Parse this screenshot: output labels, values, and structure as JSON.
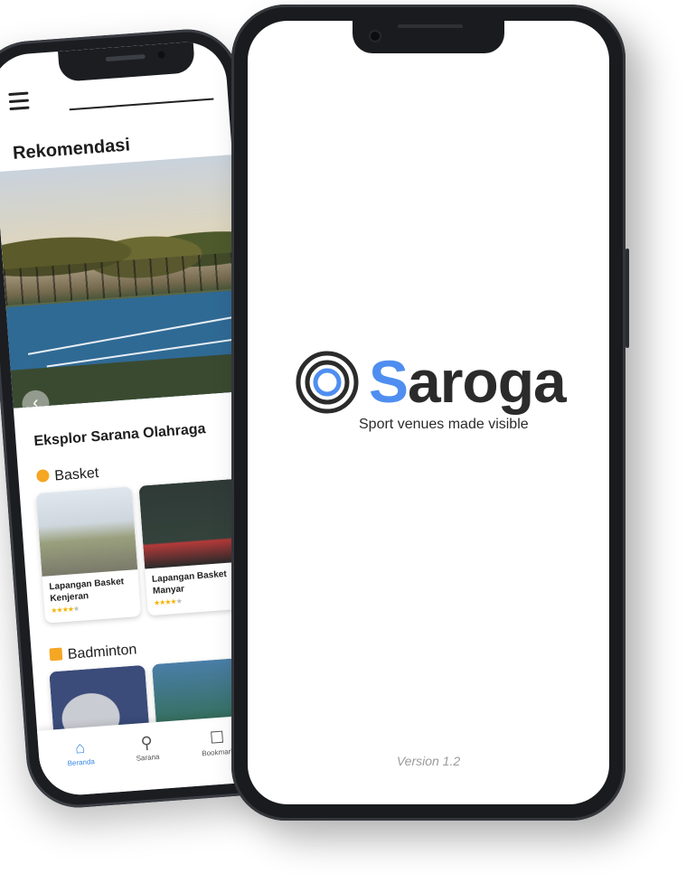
{
  "back_phone": {
    "section_title": "Rekomendasi",
    "explore_title": "Eksplor Sarana Olahraga",
    "categories": [
      {
        "label": "Basket",
        "icon": "basketball-icon",
        "color": "#f5a623",
        "venues": [
          {
            "name": "Lapangan Basket Kenjeran",
            "rating": 4
          },
          {
            "name": "Lapangan Basket Manyar",
            "rating": 4
          }
        ]
      },
      {
        "label": "Badminton",
        "icon": "shuttlecock-icon",
        "color": "#f5a623",
        "venues": []
      }
    ],
    "tabs": [
      {
        "label": "Beranda",
        "icon": "home-icon",
        "active": true
      },
      {
        "label": "Sarana",
        "icon": "location-pin-icon",
        "active": false
      },
      {
        "label": "Bookmark",
        "icon": "bookmark-icon",
        "active": false
      }
    ]
  },
  "front_phone": {
    "brand_first": "S",
    "brand_rest": "aroga",
    "tagline": "Sport venues made visible",
    "version": "Version 1.2",
    "brand_color": "#4f8ef0"
  }
}
